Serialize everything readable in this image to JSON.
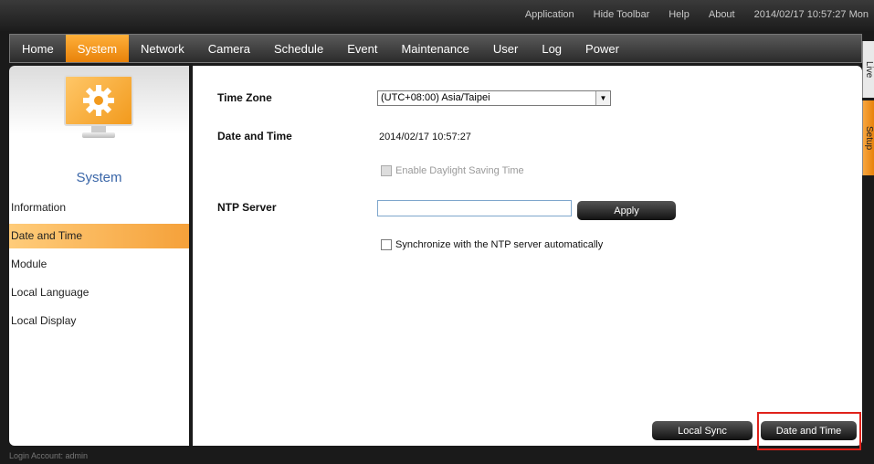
{
  "topbar": {
    "links": [
      "Application",
      "Hide Toolbar",
      "Help",
      "About"
    ],
    "datetime": "2014/02/17 10:57:27 Mon"
  },
  "nav": {
    "tabs": [
      "Home",
      "System",
      "Network",
      "Camera",
      "Schedule",
      "Event",
      "Maintenance",
      "User",
      "Log",
      "Power"
    ],
    "active": "System"
  },
  "right_tabs": {
    "live": "Live",
    "setup": "Setup"
  },
  "sidebar": {
    "title": "System",
    "items": [
      "Information",
      "Date and Time",
      "Module",
      "Local Language",
      "Local Display"
    ],
    "active": "Date and Time"
  },
  "form": {
    "time_zone_label": "Time Zone",
    "time_zone_value": "(UTC+08:00) Asia/Taipei",
    "date_time_label": "Date and Time",
    "date_time_value": "2014/02/17 10:57:27",
    "daylight_label": "Enable Daylight Saving Time",
    "ntp_label": "NTP Server",
    "ntp_value": "",
    "apply_label": "Apply",
    "sync_auto_label": "Synchronize with the NTP server automatically"
  },
  "buttons": {
    "local_sync": "Local Sync",
    "date_and_time": "Date and Time"
  },
  "footer": {
    "login": "Login Account: admin"
  },
  "colors": {
    "accent": "#f29a1d",
    "title_blue": "#3a66a8",
    "highlight": "#e0221b"
  }
}
